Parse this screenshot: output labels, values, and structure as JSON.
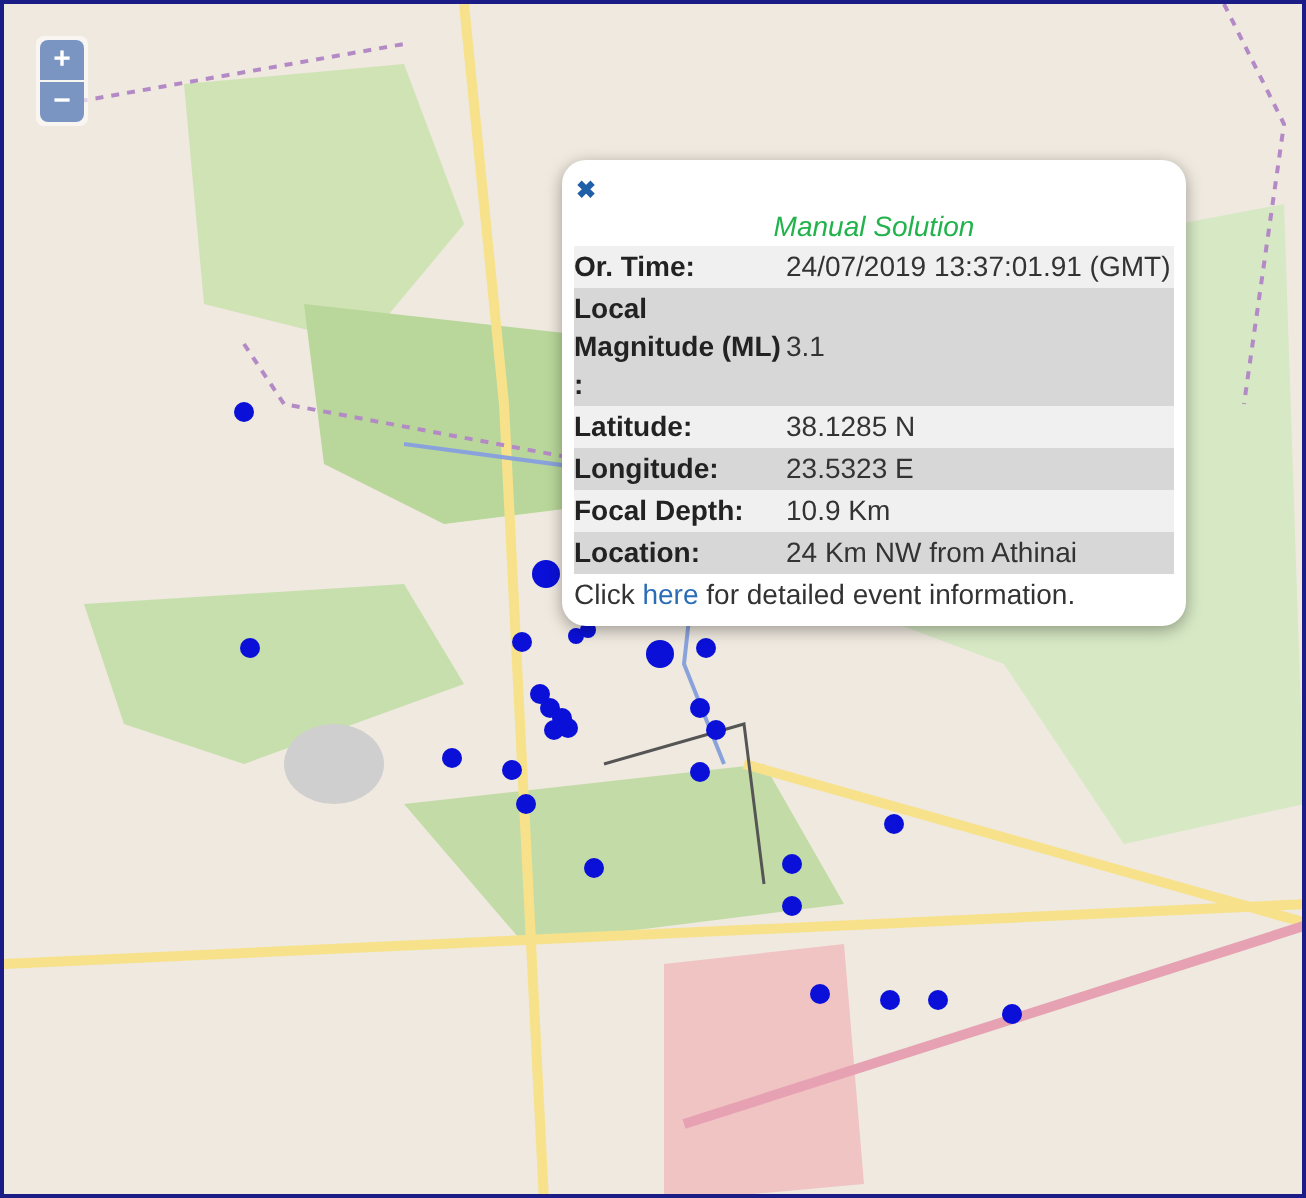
{
  "zoom_controls": [
    {
      "kind": "in",
      "label": "+"
    },
    {
      "kind": "out",
      "label": "−"
    }
  ],
  "popup": {
    "close": "✖",
    "title": "Manual Solution",
    "rows": [
      {
        "label": "Or. Time:",
        "value": "24/07/2019 13:37:01.91 (GMT)"
      },
      {
        "label": "Local Magnitude (ML) :",
        "value": "3.1"
      },
      {
        "label": "Latitude:",
        "value": "38.1285 N"
      },
      {
        "label": "Longitude:",
        "value": "23.5323 E"
      },
      {
        "label": "Focal Depth:",
        "value": "10.9 Km"
      },
      {
        "label": "Location:",
        "value": "24 Km NW from Athinai"
      }
    ],
    "footer": {
      "before": "Click",
      "link": "here",
      "after": "for detailed event information."
    }
  }
}
